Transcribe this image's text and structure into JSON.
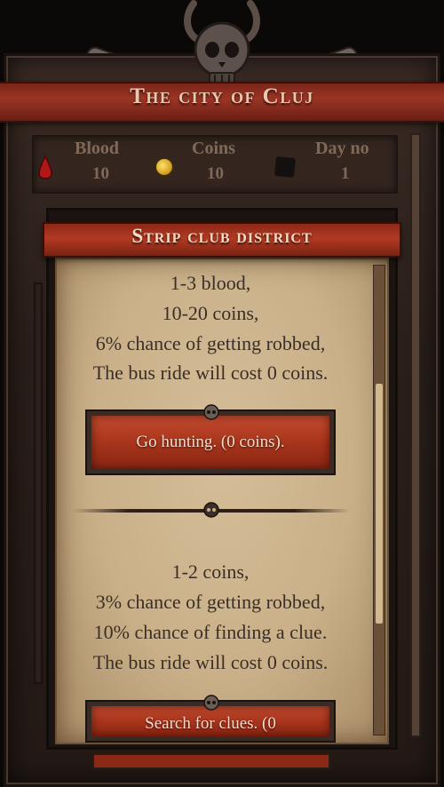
{
  "header": {
    "title": "The city of Cluj"
  },
  "stats": {
    "blood": {
      "label": "Blood",
      "value": "10",
      "icon": "blood-drop-icon"
    },
    "coins": {
      "label": "Coins",
      "value": "10",
      "icon": "coin-icon"
    },
    "day": {
      "label": "Day no",
      "value": "1",
      "icon": "day-icon"
    }
  },
  "modal": {
    "title": "Strip club district",
    "hunt": {
      "lines": [
        "1-3 blood,",
        "10-20 coins,",
        "6% chance of getting robbed,",
        "The bus ride will cost 0 coins."
      ],
      "button": "Go hunting. (0 coins)."
    },
    "clues": {
      "lines": [
        "1-2 coins,",
        "3% chance of getting robbed,",
        "10% chance of finding a clue.",
        "The bus ride will cost 0 coins."
      ],
      "button": "Search for clues. (0"
    }
  },
  "colors": {
    "banner": "#9a3524",
    "button": "#a8351c",
    "parchment": "#c9b089",
    "text": "#3a2e26"
  }
}
